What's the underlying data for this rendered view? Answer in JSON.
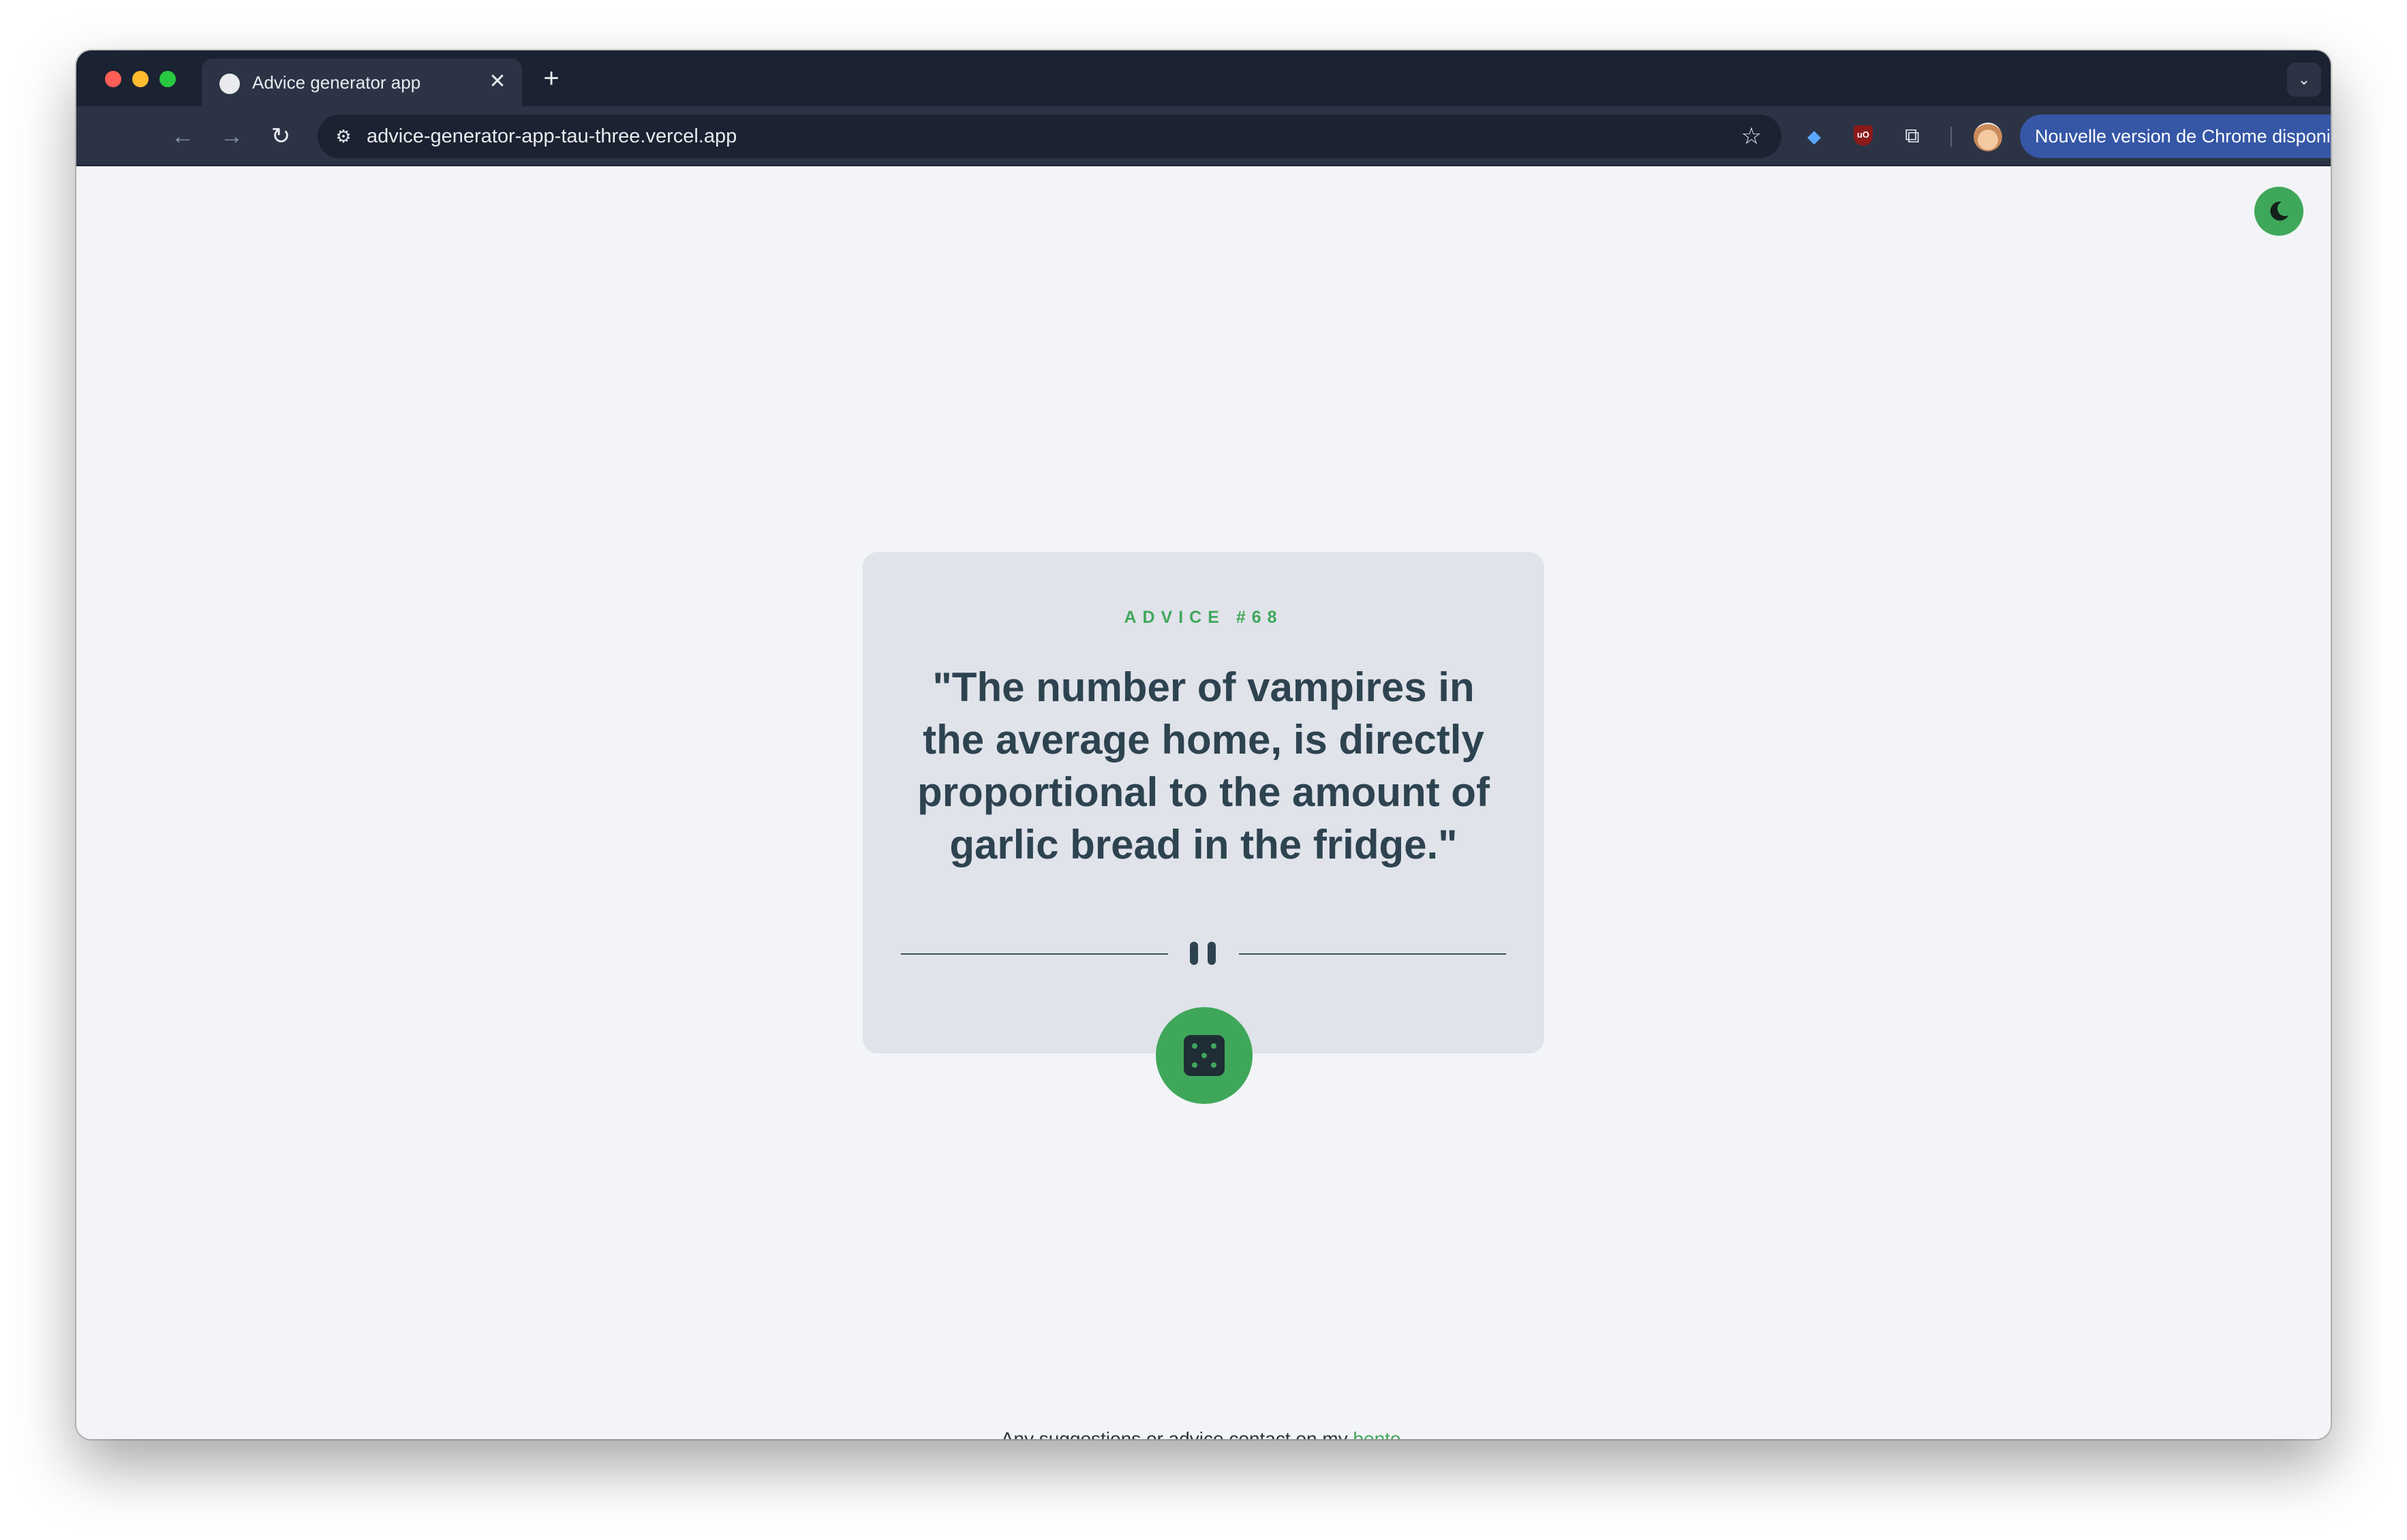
{
  "browser": {
    "tab": {
      "title": "Advice generator app",
      "close_glyph": "✕"
    },
    "new_tab_glyph": "+",
    "tab_search_glyph": "⌄",
    "nav": {
      "back_glyph": "←",
      "forward_glyph": "→",
      "reload_glyph": "↻"
    },
    "omnibox": {
      "url": "advice-generator-app-tau-three.vercel.app",
      "site_info_glyph": "⚙",
      "bookmark_glyph": "☆"
    },
    "extensions": {
      "gem_glyph": "◆",
      "ublock_label": "uO",
      "puzzle_glyph": "⧉"
    },
    "update_chip": {
      "label": "Nouvelle version de Chrome disponible",
      "menu_glyph": "⋮"
    }
  },
  "page": {
    "theme_toggle_icon": "moon-icon",
    "card": {
      "advice_label": "ADVICE #68",
      "quote": "\"The number of vampires in the average home, is directly proportional to the amount of garlic bread in the fridge.\""
    },
    "dice_button_icon": "dice-icon",
    "footer": {
      "prefix": "Any suggestions or advice contact on my ",
      "link_text": "bento",
      "suffix": "."
    }
  },
  "colors": {
    "accent": "#3fa75a",
    "card_background": "#e0e3ea",
    "page_background": "#f2f4f7",
    "quote_text": "#2e4350",
    "chrome_frame": "#1b2232",
    "update_chip": "#3557a6"
  }
}
